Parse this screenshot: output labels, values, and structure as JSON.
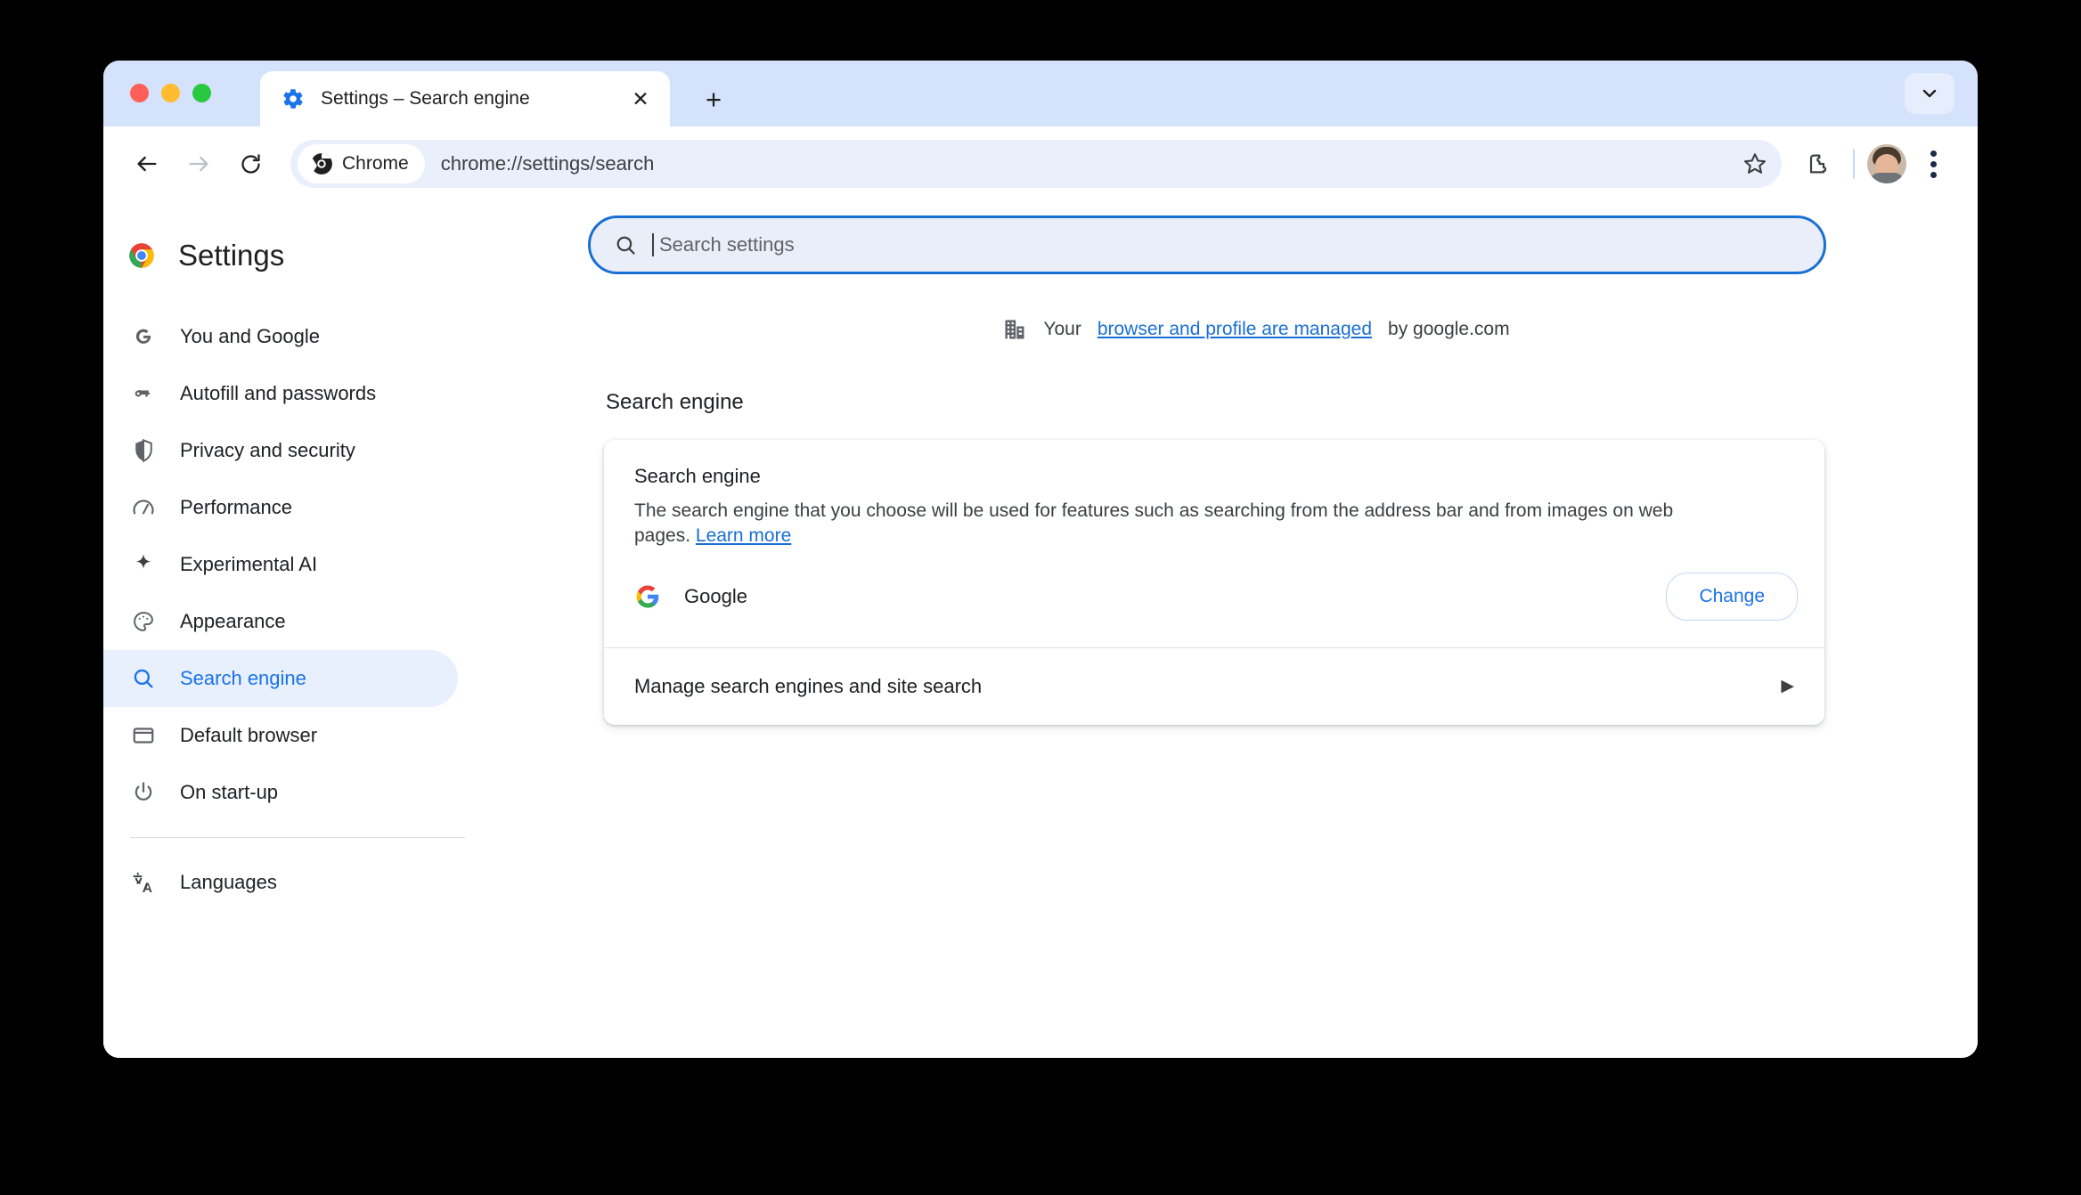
{
  "window": {
    "tab": {
      "title": "Settings – Search engine",
      "favicon": "gear-icon",
      "close_label": "✕",
      "newtab_label": "+"
    },
    "traffic_lights": [
      "close",
      "minimize",
      "zoom"
    ]
  },
  "toolbar": {
    "back": "back-arrow-icon",
    "forward": "forward-arrow-icon",
    "reload": "reload-icon",
    "chip_label": "Chrome",
    "url": "chrome://settings/search",
    "bookmark": "star-icon",
    "extensions": "puzzle-icon",
    "profile": "avatar",
    "menu": "three-dot-menu-icon"
  },
  "sidebar": {
    "brand_title": "Settings",
    "items": [
      {
        "label": "You and Google",
        "icon": "google-g-icon",
        "selected": false
      },
      {
        "label": "Autofill and passwords",
        "icon": "key-icon",
        "selected": false
      },
      {
        "label": "Privacy and security",
        "icon": "shield-icon",
        "selected": false
      },
      {
        "label": "Performance",
        "icon": "speedometer-icon",
        "selected": false
      },
      {
        "label": "Experimental AI",
        "icon": "sparkle-icon",
        "selected": false
      },
      {
        "label": "Appearance",
        "icon": "palette-icon",
        "selected": false
      },
      {
        "label": "Search engine",
        "icon": "search-icon",
        "selected": true
      },
      {
        "label": "Default browser",
        "icon": "browser-window-icon",
        "selected": false
      },
      {
        "label": "On start-up",
        "icon": "power-icon",
        "selected": false
      }
    ],
    "items_after_divider": [
      {
        "label": "Languages",
        "icon": "translate-icon",
        "selected": false
      }
    ]
  },
  "search": {
    "placeholder": "Search settings",
    "value": "",
    "icon": "search-icon",
    "focused": true
  },
  "managed_banner": {
    "icon": "office-building-icon",
    "prefix": "Your ",
    "link": "browser and profile are managed",
    "suffix": " by google.com"
  },
  "main": {
    "section_title": "Search engine",
    "card": {
      "heading": "Search engine",
      "description_part1": "The search engine that you choose will be used for features such as searching from the address bar and from images on web pages. ",
      "description_link": "Learn more",
      "engine_name": "Google",
      "engine_icon": "google-g-icon",
      "change_label": "Change",
      "manage_label": "Manage search engines and site search",
      "manage_chevron": "▶"
    }
  },
  "colors": {
    "accent_blue": "#1a73e8",
    "link_blue": "#1a6fd4",
    "tabstrip_bg": "#d4e2fc",
    "selected_nav_bg": "#e8f0fe",
    "omnibox_bg": "#eaf0fb"
  }
}
